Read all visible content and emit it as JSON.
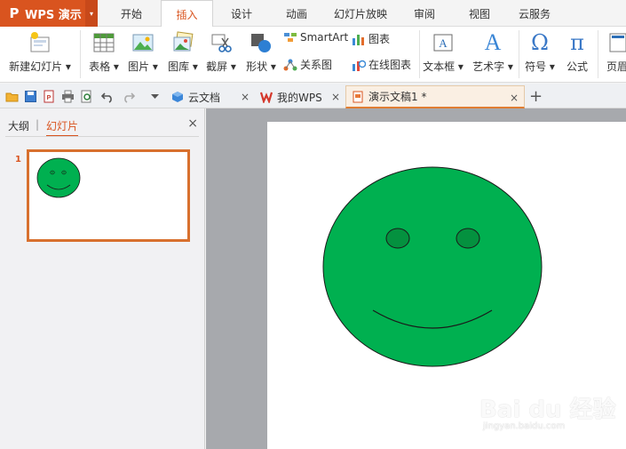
{
  "app": {
    "name": "WPS 演示",
    "logo_glyph": "P",
    "accent": "#d9541f"
  },
  "menu": {
    "tabs": [
      {
        "label": "开始"
      },
      {
        "label": "插入"
      },
      {
        "label": "设计"
      },
      {
        "label": "动画"
      },
      {
        "label": "幻灯片放映"
      },
      {
        "label": "审阅"
      },
      {
        "label": "视图"
      },
      {
        "label": "云服务"
      }
    ],
    "active_tab": "插入"
  },
  "ribbon": {
    "new_slide": "新建幻灯片",
    "table": "表格",
    "picture": "图片",
    "gallery": "图库",
    "screenshot": "截屏",
    "shape": "形状",
    "smartart": "SmartArt",
    "chart": "图表",
    "relation": "关系图",
    "online_chart": "在线图表",
    "textbox": "文本框",
    "art_text": "艺术字",
    "symbol": "符号",
    "formula": "公式",
    "header": "页眉",
    "symbol_glyph": "Ω",
    "formula_glyph": "π",
    "art_glyph": "A",
    "dropdown_glyph": "▾"
  },
  "tabbar": {
    "tabs": [
      {
        "label": "云文档",
        "close": "×"
      },
      {
        "label": "我的WPS",
        "close": "×"
      },
      {
        "label": "演示文稿1 *",
        "close": "×"
      }
    ],
    "new_tab_glyph": "+"
  },
  "panel": {
    "tab_outline": "大纲",
    "separator": "|",
    "tab_slides": "幻灯片",
    "close_glyph": "×",
    "slide_number": "1"
  },
  "slide": {
    "face_color": "#00b050",
    "eye_color": "#04913f",
    "outline_color": "#1a1a1a"
  },
  "watermark": {
    "brand": "Bai du 经验",
    "url": "jingyan.baidu.com"
  }
}
